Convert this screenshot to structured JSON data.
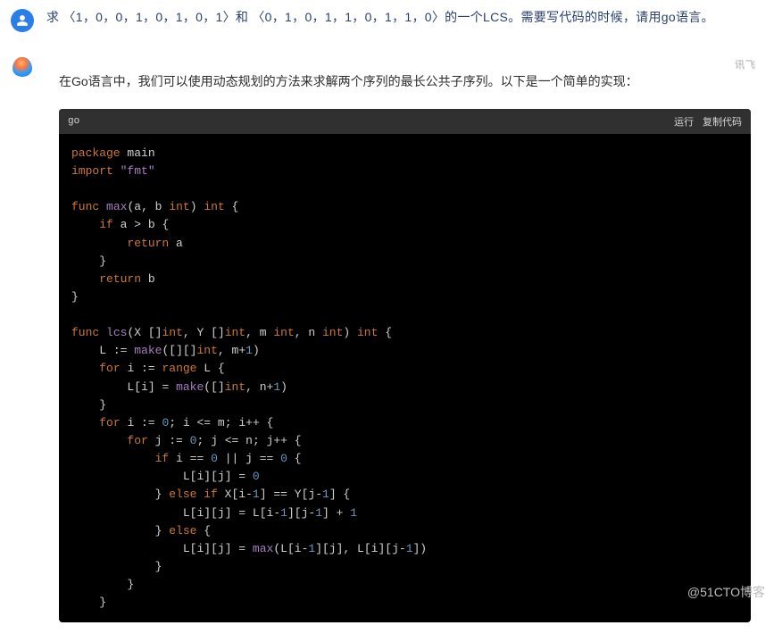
{
  "user": {
    "message": "求 〈1，0，0，1，0，1，0，1〉和 〈0，1，0，1，1，0，1，1，0〉的一个LCS。需要写代码的时候，请用go语言。"
  },
  "ai": {
    "brand_tag": "讯飞",
    "intro": "在Go语言中，我们可以使用动态规划的方法来求解两个序列的最长公共子序列。以下是一个简单的实现：",
    "code": {
      "lang": "go",
      "run_label": "运行",
      "copy_label": "复制代码",
      "lines": {
        "package_kw": "package",
        "main_id": "main",
        "import_kw": "import",
        "fmt_str": "\"fmt\"",
        "func_kw": "func",
        "max_fn": "max",
        "a_param": "a",
        "b_param": "b",
        "int_type": "int",
        "if_kw": "if",
        "return_kw": "return",
        "lcs_fn": "lcs",
        "X_param": "X",
        "Y_param": "Y",
        "m_param": "m",
        "n_param": "n",
        "make_fn": "make",
        "range_kw": "range",
        "for_kw": "for",
        "else_kw": "else",
        "L_var": "L",
        "i_var": "i",
        "j_var": "j",
        "zero": "0",
        "one": "1"
      }
    }
  },
  "watermark": "@51CTO博客"
}
